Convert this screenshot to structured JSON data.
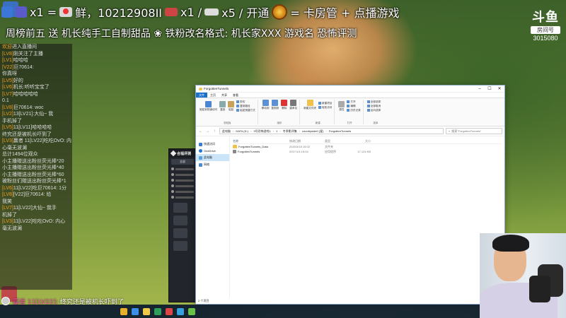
{
  "overlay": {
    "line1_a": "x1 =",
    "line1_b": "鲜，10212908II",
    "line1_c": "x1 /",
    "line1_d": "x5 / 开通",
    "line1_e": "= 卡房管 + 点播游戏",
    "line2": "周榜前五 送 机长纯手工自制甜品 ❀ 铁粉改名格式: 机长家XXX 游戏名 恐怖评测"
  },
  "logo": {
    "name": "斗鱼",
    "tag": "房间号",
    "room": "3015080"
  },
  "chat": [
    {
      "who": "欢迎",
      "text": "进入直播间"
    },
    {
      "who": "[LV8]",
      "text": "刚关注了主播"
    },
    {
      "who": "[LV1]",
      "text": "哈哈哈"
    },
    {
      "who": "[V22]",
      "text": "巨70614:"
    },
    {
      "who": "",
      "text": "你真呀"
    },
    {
      "who": "[LV5]",
      "text": "好的"
    },
    {
      "who": "[LV6]",
      "text": "机长:听听宝宝了"
    },
    {
      "who": "[LV7]",
      "text": "哈哈哈哈哈"
    },
    {
      "who": "",
      "text": "0.1"
    },
    {
      "who": "[LV8]",
      "text": "巨70614: woc"
    },
    {
      "who": "[LV2]",
      "text": "13[LV21]:大仙~ 我"
    },
    {
      "who": "",
      "text": "手机掉了"
    },
    {
      "who": "[LV5]",
      "text": "11[LV11]哈哈哈哈"
    },
    {
      "who": "",
      "text": "终究还是被机长吓到了"
    },
    {
      "who": "[LV3]",
      "text": "赢者 11[LV22]吃吃OvO: 内"
    },
    {
      "who": "",
      "text": "心毫无波澜"
    },
    {
      "who": "",
      "text": "总计1494位观众"
    },
    {
      "who": "",
      "text": "小主播赠送出粉丝荧光棒*20"
    },
    {
      "who": "",
      "text": "小主播赠送出粉丝荧光棒*40"
    },
    {
      "who": "",
      "text": "小主播赠送出粉丝荧光棒*60"
    },
    {
      "who": "",
      "text": "被粉丝们赠送出粉丝荧光棒*1"
    },
    {
      "who": "[LV6]",
      "text": "11[LV22]吃巨70614: 1分"
    },
    {
      "who": "[LV8]",
      "text": "[V22]巨70614: 给"
    },
    {
      "who": "",
      "text": "我笑"
    },
    {
      "who": "[LV7]",
      "text": "11[LV22]大仙~ 我手"
    },
    {
      "who": "",
      "text": "机掉了"
    },
    {
      "who": "[LV3]",
      "text": "11[LV22]吃吃OvO: 内心"
    },
    {
      "who": "",
      "text": "毫无波澜"
    }
  ],
  "ticker": {
    "name": "赢者 11[LV22]:",
    "text": "终究还是被机长吓到了"
  },
  "explorer": {
    "title": "ForgottenTunnels",
    "tabs": [
      "文件",
      "主页",
      "共享",
      "查看"
    ],
    "ribbon": {
      "g1": [
        "固定到快速访问",
        "复制",
        "粘贴"
      ],
      "g1_small": [
        "剪切",
        "复制路径",
        "粘贴快捷方式"
      ],
      "g1_label": "剪贴板",
      "g2": [
        "移动到",
        "复制到",
        "删除",
        "重命名"
      ],
      "g2_label": "组织",
      "g3": [
        "新建文件夹"
      ],
      "g3_small": [
        "新建项目",
        "轻松访问"
      ],
      "g3_label": "新建",
      "g4": [
        "属性"
      ],
      "g4_small": [
        "打开",
        "编辑",
        "历史记录"
      ],
      "g4_label": "打开",
      "g5_small": [
        "全部选择",
        "全部取消",
        "反向选择"
      ],
      "g5_label": "选择"
    },
    "address": [
      "此电脑",
      "DATA (D:)",
      "3号恐怖游戏1",
      "1",
      "冬季影评集",
      "countryside0 (爱)",
      "ForgottenTunnels"
    ],
    "search_placeholder": "搜索\"ForgottenTunnels\"",
    "nav": [
      {
        "label": "快速访问"
      },
      {
        "label": "OneDrive"
      },
      {
        "label": "此电脑"
      },
      {
        "label": "网络"
      }
    ],
    "columns": {
      "name": "名称",
      "date": "修改日期",
      "type": "类型",
      "size": "大小"
    },
    "files": [
      {
        "name": "ForgottenTunnels_Data",
        "date": "2020/3/18 15:02",
        "type": "文件夹",
        "size": ""
      },
      {
        "name": "ForgottenTunnels",
        "date": "2017/1/4 15:04",
        "type": "应用程序",
        "size": "17,124 KB"
      }
    ],
    "status": "2 个项目"
  },
  "darkapp": {
    "name": "合福评测",
    "tab": "全部"
  }
}
